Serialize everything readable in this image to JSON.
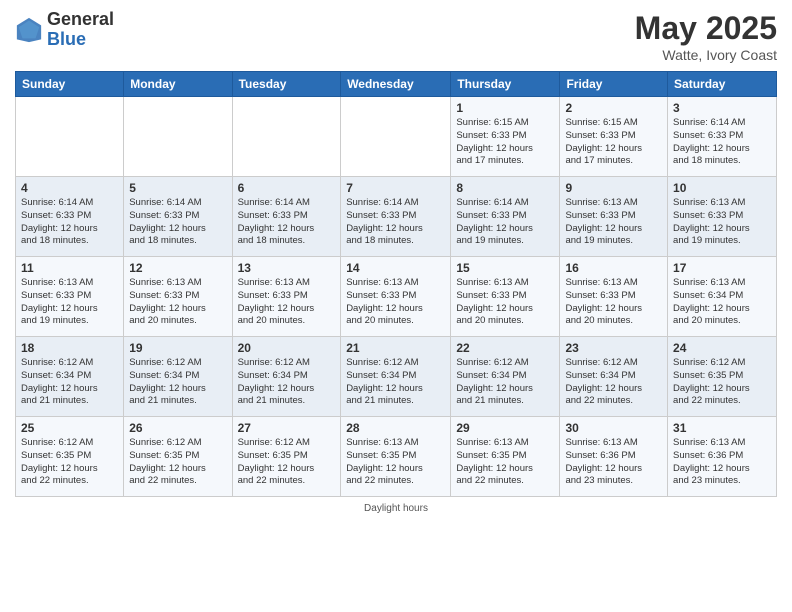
{
  "header": {
    "logo_general": "General",
    "logo_blue": "Blue",
    "title": "May 2025",
    "location": "Watte, Ivory Coast"
  },
  "days_of_week": [
    "Sunday",
    "Monday",
    "Tuesday",
    "Wednesday",
    "Thursday",
    "Friday",
    "Saturday"
  ],
  "weeks": [
    [
      {
        "day": "",
        "info": ""
      },
      {
        "day": "",
        "info": ""
      },
      {
        "day": "",
        "info": ""
      },
      {
        "day": "",
        "info": ""
      },
      {
        "day": "1",
        "info": "Sunrise: 6:15 AM\nSunset: 6:33 PM\nDaylight: 12 hours\nand 17 minutes."
      },
      {
        "day": "2",
        "info": "Sunrise: 6:15 AM\nSunset: 6:33 PM\nDaylight: 12 hours\nand 17 minutes."
      },
      {
        "day": "3",
        "info": "Sunrise: 6:14 AM\nSunset: 6:33 PM\nDaylight: 12 hours\nand 18 minutes."
      }
    ],
    [
      {
        "day": "4",
        "info": "Sunrise: 6:14 AM\nSunset: 6:33 PM\nDaylight: 12 hours\nand 18 minutes."
      },
      {
        "day": "5",
        "info": "Sunrise: 6:14 AM\nSunset: 6:33 PM\nDaylight: 12 hours\nand 18 minutes."
      },
      {
        "day": "6",
        "info": "Sunrise: 6:14 AM\nSunset: 6:33 PM\nDaylight: 12 hours\nand 18 minutes."
      },
      {
        "day": "7",
        "info": "Sunrise: 6:14 AM\nSunset: 6:33 PM\nDaylight: 12 hours\nand 18 minutes."
      },
      {
        "day": "8",
        "info": "Sunrise: 6:14 AM\nSunset: 6:33 PM\nDaylight: 12 hours\nand 19 minutes."
      },
      {
        "day": "9",
        "info": "Sunrise: 6:13 AM\nSunset: 6:33 PM\nDaylight: 12 hours\nand 19 minutes."
      },
      {
        "day": "10",
        "info": "Sunrise: 6:13 AM\nSunset: 6:33 PM\nDaylight: 12 hours\nand 19 minutes."
      }
    ],
    [
      {
        "day": "11",
        "info": "Sunrise: 6:13 AM\nSunset: 6:33 PM\nDaylight: 12 hours\nand 19 minutes."
      },
      {
        "day": "12",
        "info": "Sunrise: 6:13 AM\nSunset: 6:33 PM\nDaylight: 12 hours\nand 20 minutes."
      },
      {
        "day": "13",
        "info": "Sunrise: 6:13 AM\nSunset: 6:33 PM\nDaylight: 12 hours\nand 20 minutes."
      },
      {
        "day": "14",
        "info": "Sunrise: 6:13 AM\nSunset: 6:33 PM\nDaylight: 12 hours\nand 20 minutes."
      },
      {
        "day": "15",
        "info": "Sunrise: 6:13 AM\nSunset: 6:33 PM\nDaylight: 12 hours\nand 20 minutes."
      },
      {
        "day": "16",
        "info": "Sunrise: 6:13 AM\nSunset: 6:33 PM\nDaylight: 12 hours\nand 20 minutes."
      },
      {
        "day": "17",
        "info": "Sunrise: 6:13 AM\nSunset: 6:34 PM\nDaylight: 12 hours\nand 20 minutes."
      }
    ],
    [
      {
        "day": "18",
        "info": "Sunrise: 6:12 AM\nSunset: 6:34 PM\nDaylight: 12 hours\nand 21 minutes."
      },
      {
        "day": "19",
        "info": "Sunrise: 6:12 AM\nSunset: 6:34 PM\nDaylight: 12 hours\nand 21 minutes."
      },
      {
        "day": "20",
        "info": "Sunrise: 6:12 AM\nSunset: 6:34 PM\nDaylight: 12 hours\nand 21 minutes."
      },
      {
        "day": "21",
        "info": "Sunrise: 6:12 AM\nSunset: 6:34 PM\nDaylight: 12 hours\nand 21 minutes."
      },
      {
        "day": "22",
        "info": "Sunrise: 6:12 AM\nSunset: 6:34 PM\nDaylight: 12 hours\nand 21 minutes."
      },
      {
        "day": "23",
        "info": "Sunrise: 6:12 AM\nSunset: 6:34 PM\nDaylight: 12 hours\nand 22 minutes."
      },
      {
        "day": "24",
        "info": "Sunrise: 6:12 AM\nSunset: 6:35 PM\nDaylight: 12 hours\nand 22 minutes."
      }
    ],
    [
      {
        "day": "25",
        "info": "Sunrise: 6:12 AM\nSunset: 6:35 PM\nDaylight: 12 hours\nand 22 minutes."
      },
      {
        "day": "26",
        "info": "Sunrise: 6:12 AM\nSunset: 6:35 PM\nDaylight: 12 hours\nand 22 minutes."
      },
      {
        "day": "27",
        "info": "Sunrise: 6:12 AM\nSunset: 6:35 PM\nDaylight: 12 hours\nand 22 minutes."
      },
      {
        "day": "28",
        "info": "Sunrise: 6:13 AM\nSunset: 6:35 PM\nDaylight: 12 hours\nand 22 minutes."
      },
      {
        "day": "29",
        "info": "Sunrise: 6:13 AM\nSunset: 6:35 PM\nDaylight: 12 hours\nand 22 minutes."
      },
      {
        "day": "30",
        "info": "Sunrise: 6:13 AM\nSunset: 6:36 PM\nDaylight: 12 hours\nand 23 minutes."
      },
      {
        "day": "31",
        "info": "Sunrise: 6:13 AM\nSunset: 6:36 PM\nDaylight: 12 hours\nand 23 minutes."
      }
    ]
  ],
  "footer": "Daylight hours"
}
